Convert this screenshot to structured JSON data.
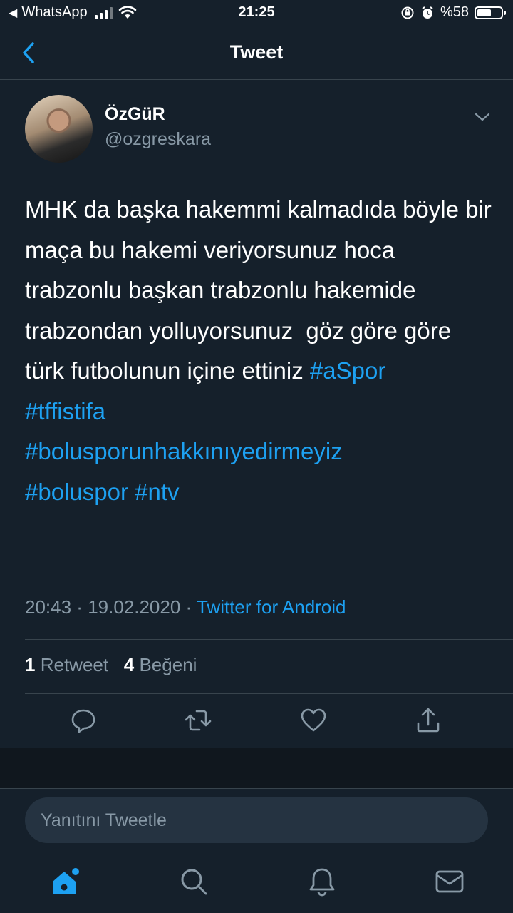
{
  "status_bar": {
    "back_app": "WhatsApp",
    "time": "21:25",
    "battery_text": "%58",
    "battery_level": 0.58
  },
  "nav": {
    "title": "Tweet",
    "back_icon": "chevron-left-icon"
  },
  "author": {
    "display_name": "ÖzGüR",
    "handle": "@ozgreskara"
  },
  "tweet": {
    "text": "MHK da başka hakemmi kalmadıda böyle bir maça bu hakemi veriyorsunuz hoca trabzonlu başkan trabzonlu hakemide trabzondan yolluyorsunuz  göz göre göre türk futbolunun içine ettiniz ",
    "hashtags": [
      "#aSpor",
      "#tffistifa",
      "#bolusporunhakkınıyedirmeyiz",
      "#boluspor",
      "#ntv"
    ],
    "time": "20:43",
    "date": "19.02.2020",
    "meta_sep": " · ",
    "source": "Twitter for Android"
  },
  "stats": {
    "retweet_count": "1",
    "retweet_label": "Retweet",
    "like_count": "4",
    "like_label": "Beğeni"
  },
  "actions": [
    "reply-icon",
    "retweet-icon",
    "heart-icon",
    "share-icon"
  ],
  "reply_box": {
    "placeholder": "Yanıtını Tweetle"
  },
  "tab_bar": [
    "home-icon",
    "search-icon",
    "bell-icon",
    "mail-icon"
  ],
  "colors": {
    "background": "#15202b",
    "accent": "#1da1f2",
    "secondary_text": "#8899a6",
    "divider": "#38444d"
  }
}
